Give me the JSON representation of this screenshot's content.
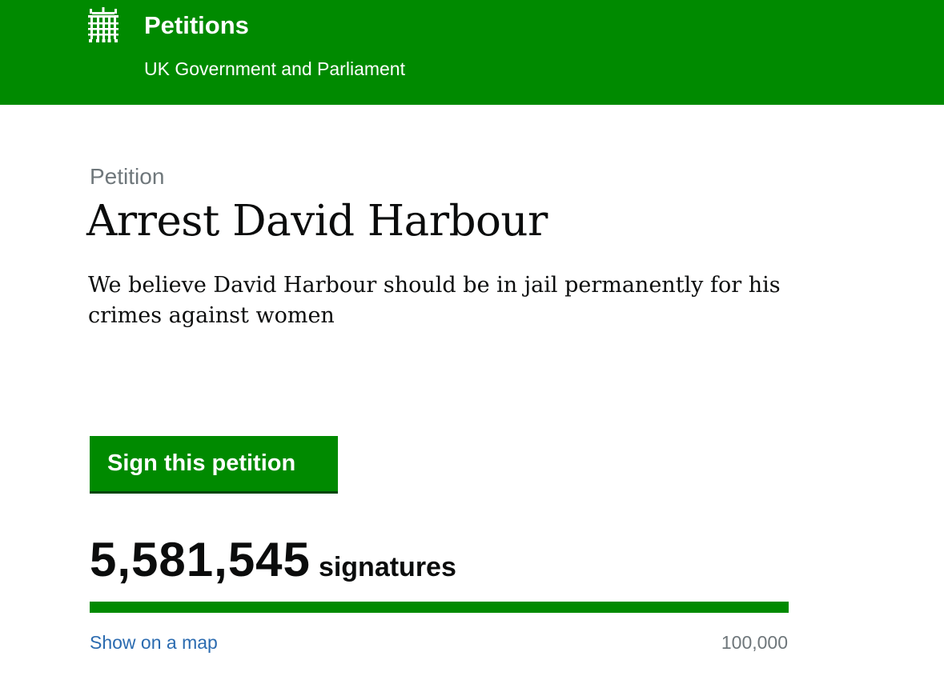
{
  "header": {
    "logo_icon": "portcullis-icon",
    "title": "Petitions",
    "subtitle": "UK Government and Parliament",
    "background_color": "#008a00"
  },
  "petition": {
    "kicker": "Petition",
    "title": "Arrest David Harbour",
    "summary": "We believe David Harbour should be in jail permanently for his crimes against women"
  },
  "actions": {
    "sign_label": "Sign this petition",
    "button_color": "#008a00"
  },
  "signatures": {
    "count": "5,581,545",
    "label": "signatures",
    "progress_fraction": 1.0,
    "threshold": "100,000",
    "map_link_label": "Show on a map",
    "link_color": "#2b6bb0"
  }
}
